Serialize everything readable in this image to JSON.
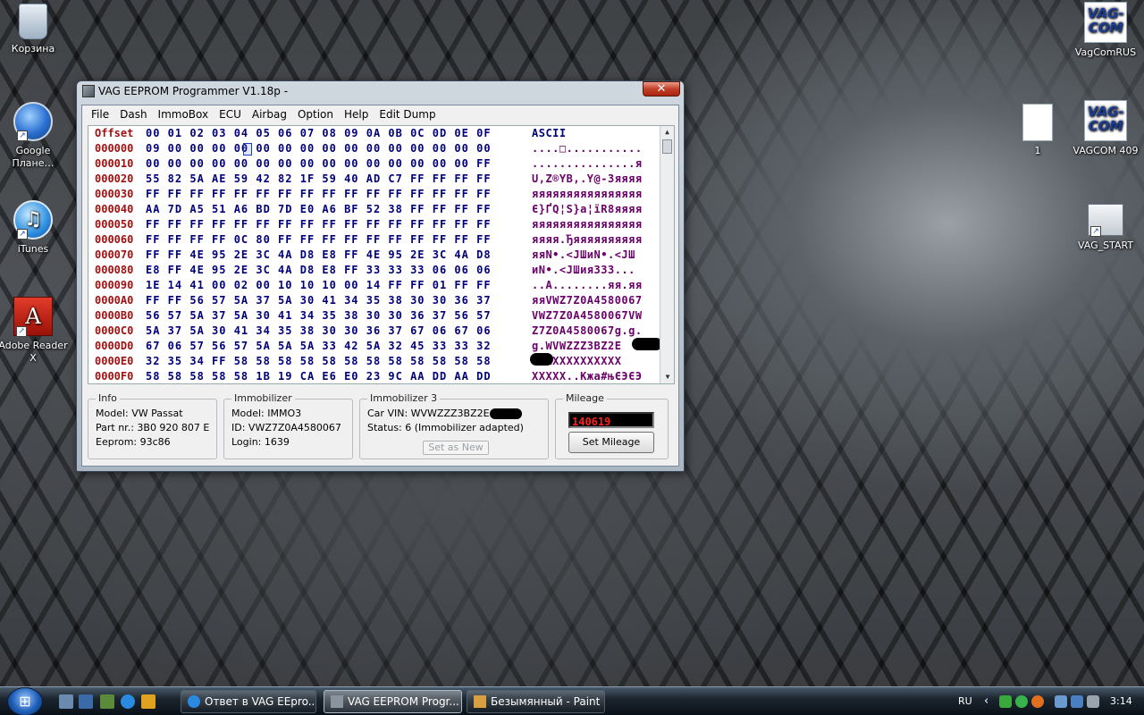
{
  "desktop": {
    "icons_left": [
      {
        "label": "Корзина"
      },
      {
        "label": "Google Плане…"
      },
      {
        "label": "iTunes"
      },
      {
        "label": "Adobe Reader X"
      }
    ],
    "icons_right": [
      {
        "label": "VagComRUS",
        "badge": "VAG-COM"
      },
      {
        "label": "1"
      },
      {
        "label": "VAGCOM 409",
        "badge": "VAG-COM"
      },
      {
        "label": "VAG_START"
      }
    ]
  },
  "window": {
    "title": "VAG EEPROM Programmer  V1.18p -",
    "close_glyph": "✕",
    "menu": [
      "File",
      "Dash",
      "ImmoBox",
      "ECU",
      "Airbag",
      "Option",
      "Help",
      "Edit Dump"
    ],
    "hex": {
      "header": {
        "offset": "Offset",
        "bytes": "00 01 02 03 04 05 06 07 08 09 0A 0B 0C 0D 0E 0F",
        "ascii": "ASCII"
      },
      "rows": [
        {
          "offset": "000000",
          "bytes": "09 00 00 00 00 00 00 00 00 00 00 00 00 00 00 00",
          "ascii": "....□..........."
        },
        {
          "offset": "000010",
          "bytes": "00 00 00 00 00 00 00 00 00 00 00 00 00 00 00 FF",
          "ascii": "...............я"
        },
        {
          "offset": "000020",
          "bytes": "55 82 5A AE 59 42 82 1F 59 40 AD C7 FF FF FF FF",
          "ascii": "U‚Z®YB‚.Y@-Зяяяя"
        },
        {
          "offset": "000030",
          "bytes": "FF FF FF FF FF FF FF FF FF FF FF FF FF FF FF FF",
          "ascii": "яяяяяяяяяяяяяяяя"
        },
        {
          "offset": "000040",
          "bytes": "AA 7D A5 51 A6 BD 7D E0 A6 BF 52 38 FF FF FF FF",
          "ascii": "Є}ҐQ¦S}а¦їR8яяяя"
        },
        {
          "offset": "000050",
          "bytes": "FF FF FF FF FF FF FF FF FF FF FF FF FF FF FF FF",
          "ascii": "яяяяяяяяяяяяяяяя"
        },
        {
          "offset": "000060",
          "bytes": "FF FF FF FF 0C 80 FF FF FF FF FF FF FF FF FF FF",
          "ascii": "яяяя.Ђяяяяяяяяяя"
        },
        {
          "offset": "000070",
          "bytes": "FF FF 4E 95 2E 3C 4A D8 E8 FF 4E 95 2E 3C 4A D8",
          "ascii": "яяN•.<JШиN•.<JШ"
        },
        {
          "offset": "000080",
          "bytes": "E8 FF 4E 95 2E 3C 4A D8 E8 FF 33 33 33 06 06 06",
          "ascii": "иN•.<JШия333..."
        },
        {
          "offset": "000090",
          "bytes": "1E 14 41 00 02 00 10 10 10 00 14 FF FF 01 FF FF",
          "ascii": "..A........яя.яя"
        },
        {
          "offset": "0000A0",
          "bytes": "FF FF 56 57 5A 37 5A 30 41 34 35 38 30 30 36 37",
          "ascii": "яяVWZ7Z0A4580067"
        },
        {
          "offset": "0000B0",
          "bytes": "56 57 5A 37 5A 30 41 34 35 38 30 30 36 37 56 57",
          "ascii": "VWZ7Z0A4580067VW"
        },
        {
          "offset": "0000C0",
          "bytes": "5A 37 5A 30 41 34 35 38 30 30 36 37 67 06 67 06",
          "ascii": "Z7Z0A4580067g.g."
        },
        {
          "offset": "0000D0",
          "bytes": "67 06 57 56 57 5A 5A 5A 33 42 5A 32 45 33 33 32",
          "ascii": "g.WVWZZZ3BZ2E"
        },
        {
          "offset": "0000E0",
          "bytes": "32 35 34 FF 58 58 58 58 58 58 58 58 58 58 58 58",
          "ascii": "яXXXXXXXXXXXX"
        },
        {
          "offset": "0000F0",
          "bytes": "58 58 58 58 58 1B 19 CA E6 E0 23 9C AA DD AA DD",
          "ascii": "XXXXX..Кжа#њЄЭЄЭ"
        }
      ]
    },
    "info": {
      "legend": "Info",
      "model": "Model:  VW Passat",
      "part": "Part nr.:  3B0 920 807 E",
      "eeprom": "Eeprom: 93c86"
    },
    "immobilizer": {
      "legend": "Immobilizer",
      "model": "Model:  IMMO3",
      "id": "ID: VWZ7Z0A4580067",
      "login": "Login: 1639"
    },
    "immobilizer3": {
      "legend": "Immobilizer 3",
      "vin": "Car VIN:  WVWZZZ3BZ2E",
      "status": "Status: 6 (Immobilizer adapted)",
      "set_new": "Set as New"
    },
    "mileage": {
      "legend": "Mileage",
      "value": "140619",
      "set_button": "Set Mileage"
    }
  },
  "taskbar": {
    "tasks": [
      {
        "label": "Ответ в VAG EEpro..."
      },
      {
        "label": "VAG EEPROM Progr..."
      },
      {
        "label": "Безымянный - Paint"
      }
    ],
    "lang": "RU",
    "clock": "3:14"
  }
}
